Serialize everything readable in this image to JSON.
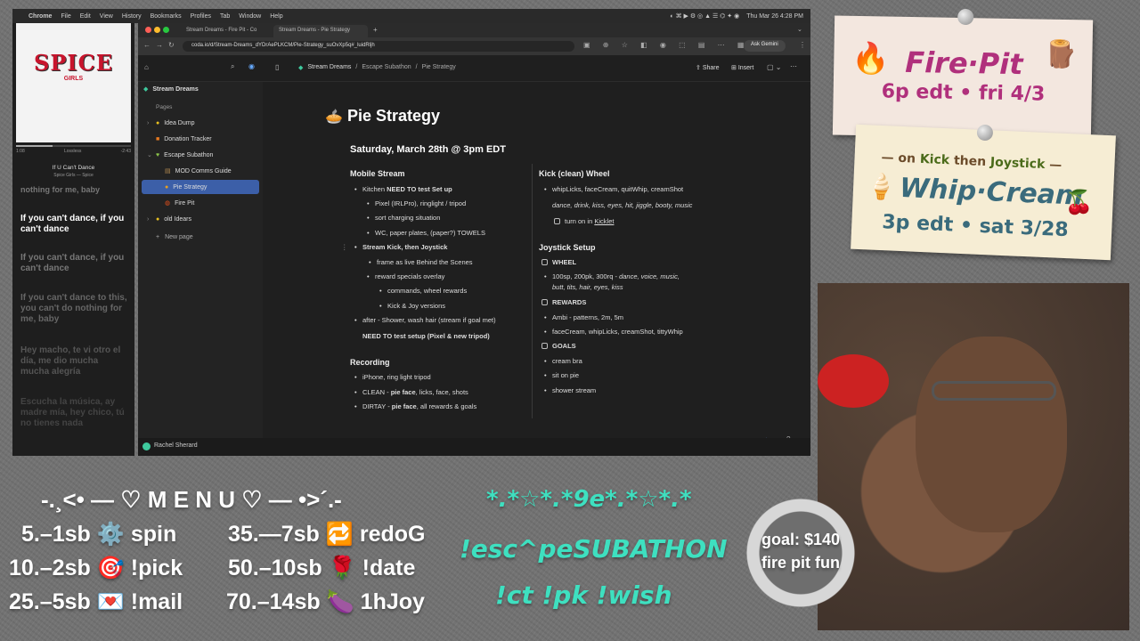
{
  "menubar": {
    "app": "Chrome",
    "items": [
      "File",
      "Edit",
      "View",
      "History",
      "Bookmarks",
      "Profiles",
      "Tab",
      "Window",
      "Help"
    ],
    "clock": "Thu Mar 26  4:28 PM"
  },
  "music": {
    "album_logo": "SPICE",
    "album_sub": "GIRLS",
    "elapsed": "1:08",
    "quality": "Lossless",
    "remaining": "-2:43",
    "progress": 0.32,
    "title": "If U Can't Dance",
    "artist": "Spice Girls — Spice",
    "lyrics": [
      "nothing for me, baby",
      "If you can't dance, if you can't dance",
      "If you can't dance, if you can't dance",
      "If you can't dance to this, you can't do nothing for me, baby",
      "Hey macho, te vi otro el día, me dio mucha mucha alegría",
      "Escucha la música, ay madre mía, hey chico, tú no tienes nada"
    ]
  },
  "browser": {
    "tab1": "Stream Dreams - Fire Pit - Co",
    "tab2": "Stream Dreams - Pie Strategy",
    "url": "coda.io/d/Stream-Dreams_dYDrAePLKCM/Pie-Strategy_suOvXp5q#_luidRljh",
    "ask": "Ask Gemini"
  },
  "coda": {
    "breadcrumb": [
      "Stream Dreams",
      "Escape Subathon",
      "Pie Strategy"
    ],
    "share": "Share",
    "insert": "Insert",
    "workspace": "Stream Dreams",
    "pages_label": "Pages",
    "pages": [
      "Idea Dump",
      "Donation Tracker",
      "Escape Subathon",
      "MOD Comms Guide",
      "Pie Strategy",
      "Fire Pit",
      "old Idears"
    ],
    "new_page": "New page",
    "user": "Rachel Sherard"
  },
  "doc": {
    "title": "Pie Strategy",
    "date": "Saturday, March 28th @ 3pm EDT",
    "mobile": {
      "heading": "Mobile Stream",
      "kitchen_a": "Kitchen ",
      "kitchen_b": "NEED TO test Set up",
      "pixel": "Pixel (IRLPro), ringlight / tripod",
      "charging": "sort charging situation",
      "wc": "WC, paper plates, (paper?) TOWELS",
      "stream": "Stream Kick, then Joystick",
      "frame": "frame as live Behind the Scenes",
      "reward": "reward specials overlay",
      "commands": "commands, wheel rewards",
      "kickjoy": "Kick & Joy versions",
      "after": "after - Shower, wash hair (stream if goal met)",
      "need": "NEED TO test  setup (Pixel & new tripod)"
    },
    "recording": {
      "heading": "Recording",
      "iphone": "iPhone, ring light tripod",
      "clean_a": "CLEAN - ",
      "clean_b": "pie face",
      "clean_c": ", licks, face, shots",
      "dirty_a": "DIRTAY - ",
      "dirty_b": "pie face",
      "dirty_c": ", all rewards & goals"
    },
    "kick": {
      "heading": "Kick (clean) Wheel",
      "items": "whipLicks, faceCream, quitWhip, creamShot",
      "italic": "dance, drink, kiss, eyes, hit, jiggle, booty, music",
      "turn_a": "turn on in  ",
      "turn_b": "Kicklet"
    },
    "joystick": {
      "heading": "Joystick Setup",
      "wheel": "WHEEL",
      "wheel_a": "100sp, 200pk, 300rq - ",
      "wheel_b": "dance, voice, music,",
      "wheel_c": "butt, tits, hair, eyes, kiss",
      "rewards": "REWARDS",
      "ambi": "Ambi - patterns, 2m, 5m",
      "cream": "faceCream, whipLicks, creamShot, tittyWhip",
      "goals": "GOALS",
      "g1": "cream bra",
      "g2": "sit on pie",
      "g3": "shower stream"
    }
  },
  "card1": {
    "line1": "Fire·Pit",
    "line2": "6p edt • fri 4/3"
  },
  "card2": {
    "line0a": "— on ",
    "line0b": "Kick",
    "line0c": " then ",
    "line0d": "Joystick",
    "line0e": " —",
    "line1": "Whip·Cream",
    "line2": "3p edt • sat 3/28"
  },
  "menu": {
    "title": "-.¸<• — ♡ M E N U ♡ — •>´.-",
    "items": [
      "5.–1sb ⚙️ spin",
      "35.—7sb 🔁 redoG",
      "10.–2sb 🎯 !pick",
      "50.–10sb 🌹 !date",
      "25.–5sb 💌 !mail",
      "70.–14sb 🍆 1hJoy"
    ]
  },
  "teal": {
    "deco": "*.*☆*.*9e*.*☆*.*",
    "cmd": "!esc^peSUBATHON",
    "cmds2": "!ct !pk !wish"
  },
  "goal": {
    "line1": "goal: $140",
    "line2": "fire pit fun"
  }
}
